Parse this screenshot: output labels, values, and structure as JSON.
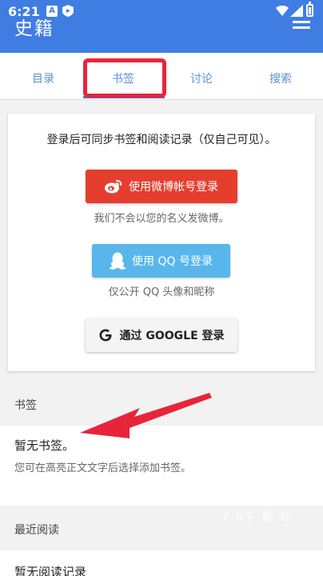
{
  "status_bar": {
    "time": "6:21",
    "badge_a": "A"
  },
  "app": {
    "title": "史籍"
  },
  "tabs": [
    {
      "label": "目录"
    },
    {
      "label": "书签"
    },
    {
      "label": "讨论"
    },
    {
      "label": "搜索"
    }
  ],
  "login": {
    "intro": "登录后可同步书签和阅读记录（仅自己可见）。",
    "weibo_button": "使用微博帐号登录",
    "weibo_note": "我们不会以您的名义发微博。",
    "qq_button": "使用 QQ 号登录",
    "qq_note": "仅公开 QQ 头像和昵称",
    "google_button": "通过 GOOGLE 登录"
  },
  "bookmarks": {
    "header": "书签",
    "empty_title": "暂无书签。",
    "empty_hint": "您可在高亮正文文字后选择添加书签。"
  },
  "recent": {
    "header": "最近阅读",
    "empty_title": "暂无阅读记录"
  },
  "watermark": "7 8下 载 站",
  "colors": {
    "appbar": "#3f7de3",
    "tab_text": "#5b8fd8",
    "highlight": "#e8243a",
    "weibo": "#e53e2f",
    "qq": "#59b6ec"
  }
}
